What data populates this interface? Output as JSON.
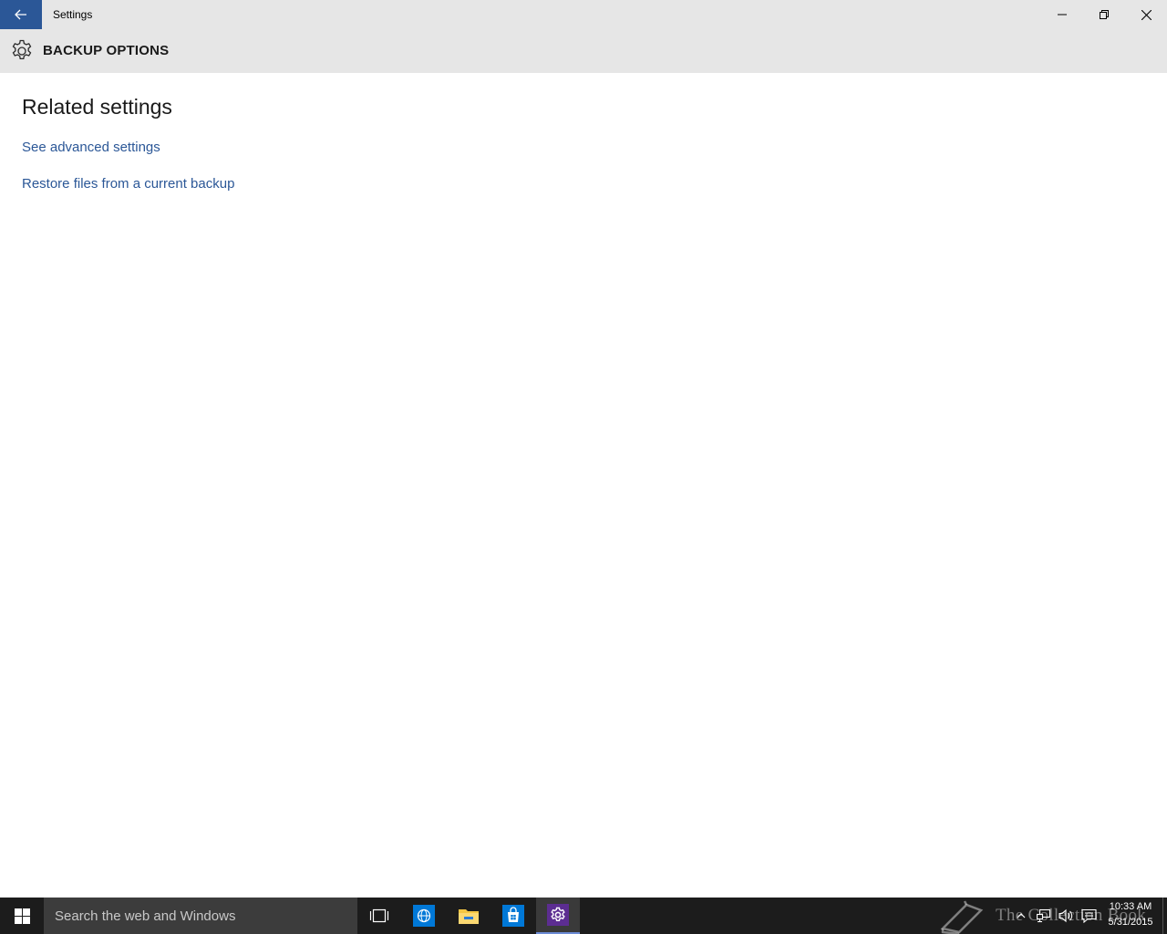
{
  "window": {
    "title": "Settings",
    "back_icon": "arrow-left-icon",
    "controls": [
      "minimize-icon",
      "restore-icon",
      "close-icon"
    ]
  },
  "header": {
    "icon": "gear-icon",
    "title": "BACKUP OPTIONS"
  },
  "content": {
    "section_title": "Related settings",
    "links": [
      {
        "label": "See advanced settings"
      },
      {
        "label": "Restore files from a current backup"
      }
    ]
  },
  "taskbar": {
    "search_placeholder": "Search the web and Windows",
    "apps": [
      "task-view-icon",
      "internet-explorer-icon",
      "file-explorer-icon",
      "store-icon",
      "settings-icon"
    ],
    "active_app": "settings-icon",
    "watermark": "The Collection Book",
    "clock": {
      "time": "10:33 AM",
      "date": "5/31/2015"
    }
  },
  "colors": {
    "accent": "#2b5797",
    "titlebar_bg": "#e6e6e6",
    "taskbar_bg": "#1c1c1c",
    "link": "#2b5797"
  }
}
